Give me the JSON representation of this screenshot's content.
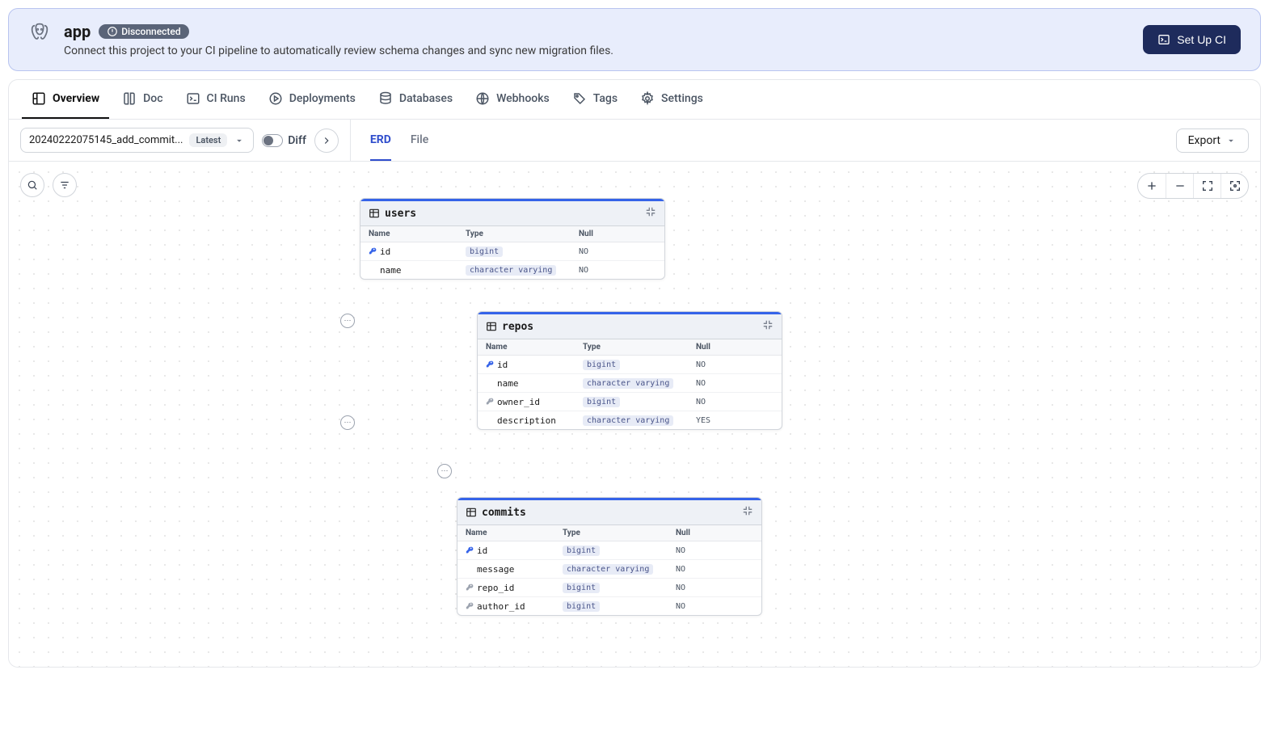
{
  "banner": {
    "title": "app",
    "badge": "Disconnected",
    "subtitle": "Connect this project to your CI pipeline to automatically review schema changes and sync new migration files.",
    "cta": "Set Up CI"
  },
  "tabs": {
    "overview": "Overview",
    "doc": "Doc",
    "ci_runs": "CI Runs",
    "deployments": "Deployments",
    "databases": "Databases",
    "webhooks": "Webhooks",
    "tags": "Tags",
    "settings": "Settings"
  },
  "toolbar": {
    "migration_name": "20240222075145_add_commit...",
    "latest_label": "Latest",
    "diff_label": "Diff",
    "subtab_erd": "ERD",
    "subtab_file": "File",
    "export_label": "Export"
  },
  "erd": {
    "column_headers": {
      "name": "Name",
      "type": "Type",
      "null": "Null"
    },
    "tables": {
      "users": {
        "name": "users",
        "columns": [
          {
            "name": "id",
            "type": "bigint",
            "null": "NO",
            "key": "pk"
          },
          {
            "name": "name",
            "type": "character varying",
            "null": "NO"
          }
        ]
      },
      "repos": {
        "name": "repos",
        "columns": [
          {
            "name": "id",
            "type": "bigint",
            "null": "NO",
            "key": "pk"
          },
          {
            "name": "name",
            "type": "character varying",
            "null": "NO"
          },
          {
            "name": "owner_id",
            "type": "bigint",
            "null": "NO",
            "key": "fk"
          },
          {
            "name": "description",
            "type": "character varying",
            "null": "YES"
          }
        ]
      },
      "commits": {
        "name": "commits",
        "columns": [
          {
            "name": "id",
            "type": "bigint",
            "null": "NO",
            "key": "pk"
          },
          {
            "name": "message",
            "type": "character varying",
            "null": "NO"
          },
          {
            "name": "repo_id",
            "type": "bigint",
            "null": "NO",
            "key": "fk"
          },
          {
            "name": "author_id",
            "type": "bigint",
            "null": "NO",
            "key": "fk"
          }
        ]
      }
    }
  }
}
